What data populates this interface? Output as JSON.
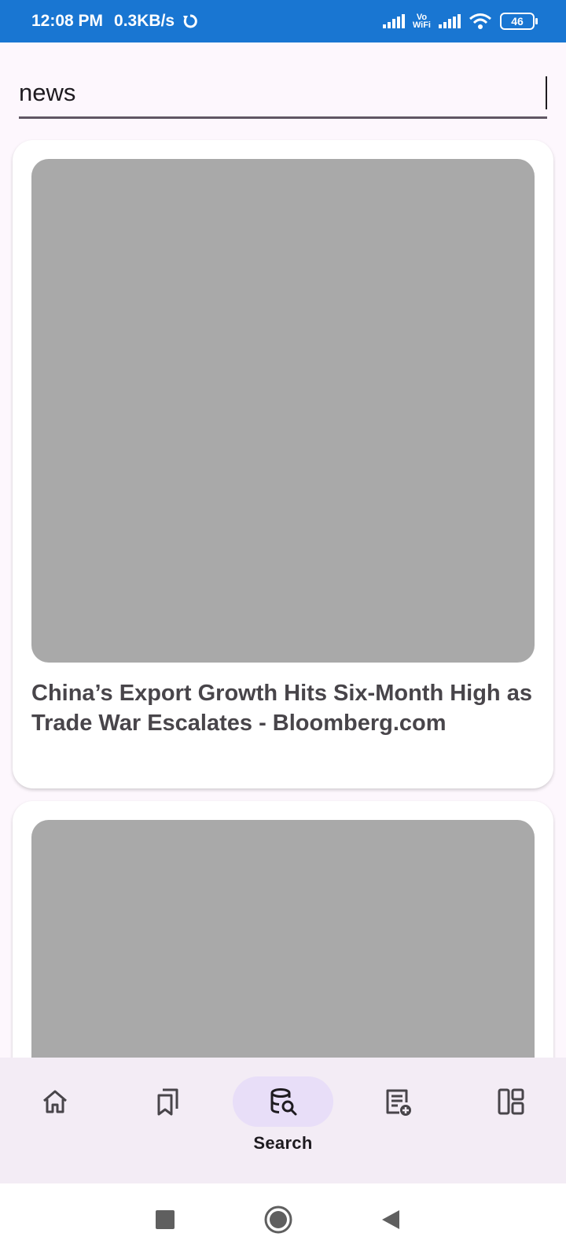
{
  "status_bar": {
    "time": "12:08 PM",
    "net_speed": "0.3KB/s",
    "vowifi_top": "Vo",
    "vowifi_bottom": "WiFi",
    "battery": "46"
  },
  "search": {
    "value": "news"
  },
  "articles": [
    {
      "headline": "China’s Export Growth Hits Six-Month High as Trade War Escalates - Bloomberg.com"
    },
    {
      "headline": ""
    }
  ],
  "bottom_nav": {
    "items": [
      {
        "icon": "home-icon",
        "label": ""
      },
      {
        "icon": "bookmarks-icon",
        "label": ""
      },
      {
        "icon": "search-database-icon",
        "label": "Search",
        "active": true
      },
      {
        "icon": "add-note-icon",
        "label": ""
      },
      {
        "icon": "dashboard-icon",
        "label": ""
      }
    ]
  },
  "colors": {
    "status_bar": "#1976d2",
    "background": "#fdf7fd",
    "nav_background": "#f3ecf5",
    "active_pill": "#e8def8",
    "thumbnail_placeholder": "#a9a9a9"
  }
}
